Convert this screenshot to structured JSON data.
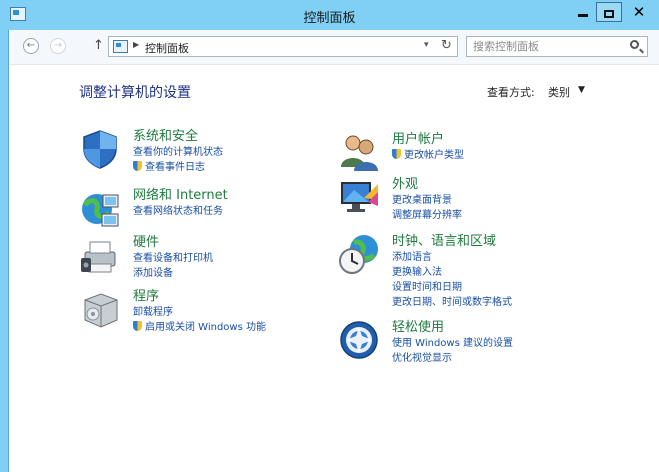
{
  "window": {
    "title": "控制面板"
  },
  "nav": {
    "back_glyph": "←",
    "forward_glyph": "→",
    "up_glyph": "↑",
    "address": "控制面板",
    "address_caret": "▶",
    "dropdown_glyph": "▾",
    "refresh_glyph": "↻",
    "search_placeholder": "搜索控制面板"
  },
  "header": {
    "title": "调整计算机的设置",
    "view_by_label": "查看方式:",
    "view_by_value": "类别",
    "view_by_arrow": "▼"
  },
  "categories": [
    {
      "title": "系统和安全",
      "links": [
        "查看你的计算机状态",
        "查看事件日志"
      ]
    },
    {
      "title": "网络和 Internet",
      "links": [
        "查看网络状态和任务"
      ]
    },
    {
      "title": "硬件",
      "links": [
        "查看设备和打印机",
        "添加设备"
      ]
    },
    {
      "title": "程序",
      "links": [
        "卸载程序",
        "启用或关闭 Windows 功能"
      ]
    },
    {
      "title": "用户帐户",
      "links": [
        "更改帐户类型"
      ]
    },
    {
      "title": "外观",
      "links": [
        "更改桌面背景",
        "调整屏幕分辨率"
      ]
    },
    {
      "title": "时钟、语言和区域",
      "links": [
        "添加语言",
        "更换输入法",
        "设置时间和日期",
        "更改日期、时间或数字格式"
      ]
    },
    {
      "title": "轻松使用",
      "links": [
        "使用 Windows 建议的设置",
        "优化视觉显示"
      ]
    }
  ],
  "colors": {
    "title_bar": "#7fd0f4",
    "category_title": "#1e7a3e",
    "link": "#1a4fa3",
    "heading": "#1e3287"
  }
}
